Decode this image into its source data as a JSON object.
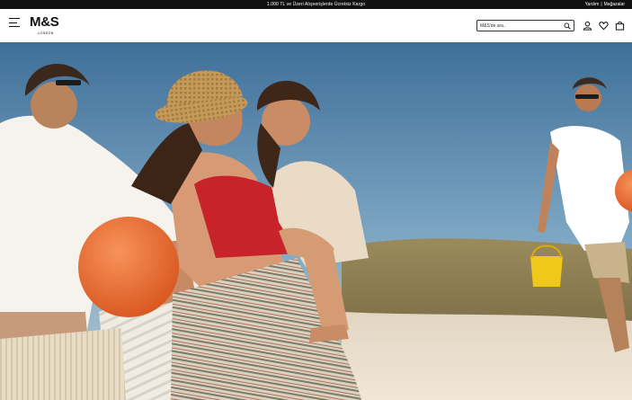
{
  "promo": {
    "text": "1.000 TL ve Üzeri Alışverişlerde Ücretsiz Kargo",
    "help_link": "Yardım",
    "separator": "|",
    "stores_link": "Mağazalar"
  },
  "header": {
    "logo_text": "M&S",
    "logo_subtext": "LONDON",
    "search_placeholder": "M&S'de ara..",
    "icons": [
      "menu-icon",
      "search-icon",
      "account-icon",
      "wishlist-icon",
      "bag-icon"
    ]
  },
  "hero": {
    "image": "family-beach-summer-photo"
  }
}
